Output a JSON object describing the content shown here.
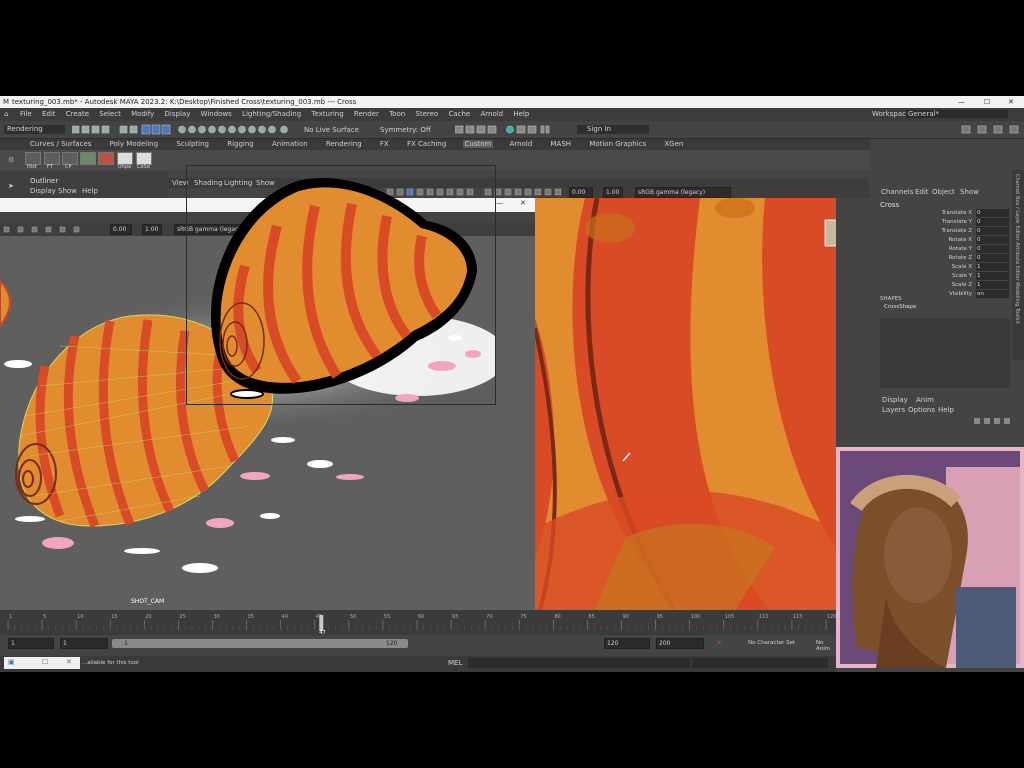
{
  "window": {
    "title": "texturing_003.mb* - Autodesk MAYA 2023.2: K:\\Desktop\\Finished Cross\\texturing_003.mb --- Cross",
    "min": "—",
    "max": "☐",
    "close": "✕"
  },
  "menu": [
    "File",
    "Edit",
    "Create",
    "Select",
    "Modify",
    "Display",
    "Windows",
    "Lighting/Shading",
    "Texturing",
    "Render",
    "Toon",
    "Stereo",
    "Cache",
    "Arnold",
    "Help"
  ],
  "workspace": {
    "label": "Workspace:",
    "value": "General*"
  },
  "status": {
    "mode": "Rendering",
    "live": "No Live Surface",
    "symmetry": "Symmetry: Off",
    "signin": "Sign In"
  },
  "shelf_tabs": [
    "Curves / Surfaces",
    "Poly Modeling",
    "Sculpting",
    "Rigging",
    "Animation",
    "Rendering",
    "FX",
    "FX Caching",
    "Custom",
    "Arnold",
    "MASH",
    "Motion Graphics",
    "XGen"
  ],
  "shelf_icons": [
    "Hist",
    "FT",
    "CP",
    "",
    "",
    "Unpa",
    "CoSd"
  ],
  "outliner": {
    "title": "Outliner",
    "menu": [
      "Display",
      "Show",
      "Help"
    ]
  },
  "panel_menu": [
    "View",
    "Shading",
    "Lighting",
    "Show"
  ],
  "viewport_left": {
    "exposure": "0.00",
    "gamma": "1.00",
    "colorspace": "sRGB gamma (legacy)",
    "camera": "SHOT_CAM"
  },
  "viewport_right": {
    "exposure": "0.00",
    "gamma": "1.00",
    "colorspace": "sRGB gamma (legacy)"
  },
  "channel_box": {
    "tabs": [
      "Channels",
      "Edit",
      "Object",
      "Show"
    ],
    "object": "Cross",
    "attrs": [
      {
        "name": "Translate X",
        "value": "0"
      },
      {
        "name": "Translate Y",
        "value": "0"
      },
      {
        "name": "Translate Z",
        "value": "0"
      },
      {
        "name": "Rotate X",
        "value": "0"
      },
      {
        "name": "Rotate Y",
        "value": "0"
      },
      {
        "name": "Rotate Z",
        "value": "0"
      },
      {
        "name": "Scale X",
        "value": "1"
      },
      {
        "name": "Scale Y",
        "value": "1"
      },
      {
        "name": "Scale Z",
        "value": "1"
      },
      {
        "name": "Visibility",
        "value": "on"
      }
    ],
    "shapes_label": "SHAPES",
    "shape": "CrossShape",
    "layer_tabs": [
      "Display",
      "Anim"
    ],
    "layer_menu": [
      "Layers",
      "Options",
      "Help"
    ]
  },
  "side_tabs": "Channel Box / Layer Editor   Attribute Editor   Modelling Toolkit",
  "timeline": {
    "ticks": [
      "1",
      "5",
      "10",
      "15",
      "20",
      "25",
      "30",
      "35",
      "40",
      "45",
      "50",
      "55",
      "60",
      "65",
      "70",
      "75",
      "80",
      "85",
      "90",
      "95",
      "100",
      "105",
      "110",
      "115",
      "120"
    ],
    "current": "47",
    "current_fraction": 0.383
  },
  "range": {
    "start": "1",
    "inner_start": "1",
    "slider_start": "1",
    "slider_end": "120",
    "end": "120",
    "outer_end": "200",
    "character": "No Character Set",
    "anim": "No Anim"
  },
  "command": {
    "lang": "MEL",
    "help": "...ailable for this tool"
  },
  "colors": {
    "orange": "#e08c2f",
    "red": "#d94a26",
    "brown": "#7a2a14",
    "pink": "#f2a5c0",
    "maya_dark": "#444444"
  }
}
